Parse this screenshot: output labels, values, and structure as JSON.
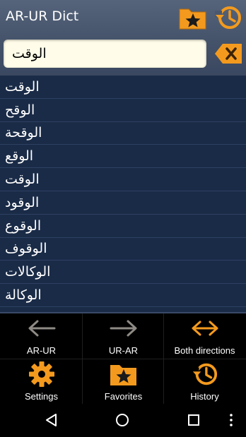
{
  "app": {
    "title": "AR-UR Dict"
  },
  "search": {
    "value": "الوقت"
  },
  "results": [
    "الوقت",
    "الوقح",
    "الوقحة",
    "الوقع",
    "الوقت",
    "الوقود",
    "الوقوع",
    "الوقوف",
    "الوكالات",
    "الوكالة"
  ],
  "bottom": {
    "ar_ur": "AR-UR",
    "ur_ar": "UR-AR",
    "both": "Both directions",
    "settings": "Settings",
    "favorites": "Favorites",
    "history": "History"
  },
  "colors": {
    "accent": "#f39a1e",
    "list_bg": "#1a2b47",
    "header": "#4a586f"
  }
}
